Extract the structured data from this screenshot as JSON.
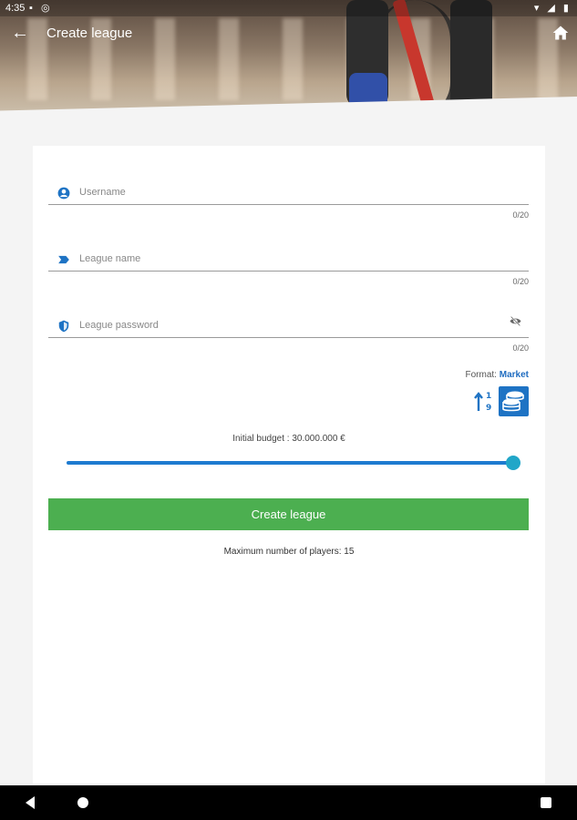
{
  "status_bar": {
    "time": "4:35"
  },
  "app_bar": {
    "title": "Create league"
  },
  "form": {
    "username": {
      "placeholder": "Username",
      "counter": "0/20"
    },
    "league_name": {
      "placeholder": "League name",
      "counter": "0/20"
    },
    "league_password": {
      "placeholder": "League password",
      "counter": "0/20"
    },
    "format": {
      "label": "Format:",
      "value": "Market"
    },
    "budget_label": "Initial budget : 30.000.000 €",
    "budget_slider_level": 1.0,
    "create_button": "Create league",
    "max_players": "Maximum number of players: 15"
  },
  "colors": {
    "accent": "#1e73c4",
    "button": "#4caf50",
    "slider_thumb": "#21a6c8"
  },
  "icons": [
    "arrow-back-icon",
    "home-icon",
    "user-circle-icon",
    "label-tag-icon",
    "shield-icon",
    "eye-off-icon",
    "sort-numeric-icon",
    "coins-stack-icon"
  ]
}
